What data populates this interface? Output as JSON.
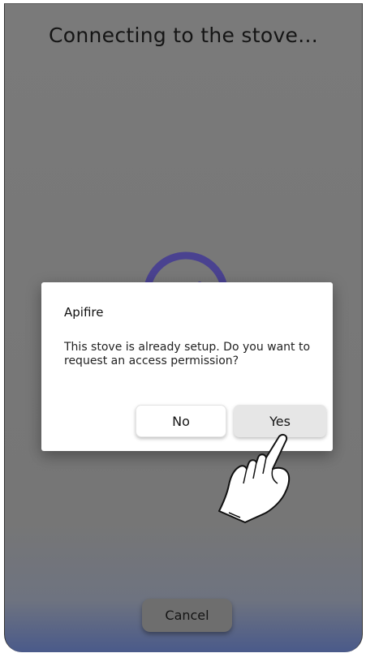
{
  "screen": {
    "title": "Connecting to the stove...",
    "spinner_color": "#5b4fa8",
    "cancel_label": "Cancel"
  },
  "dialog": {
    "title": "Apifire",
    "message": "This stove is already setup. Do you want to request an access permission?",
    "no_label": "No",
    "yes_label": "Yes"
  },
  "overlay": {
    "pointer_icon": "hand-pointer-icon"
  }
}
